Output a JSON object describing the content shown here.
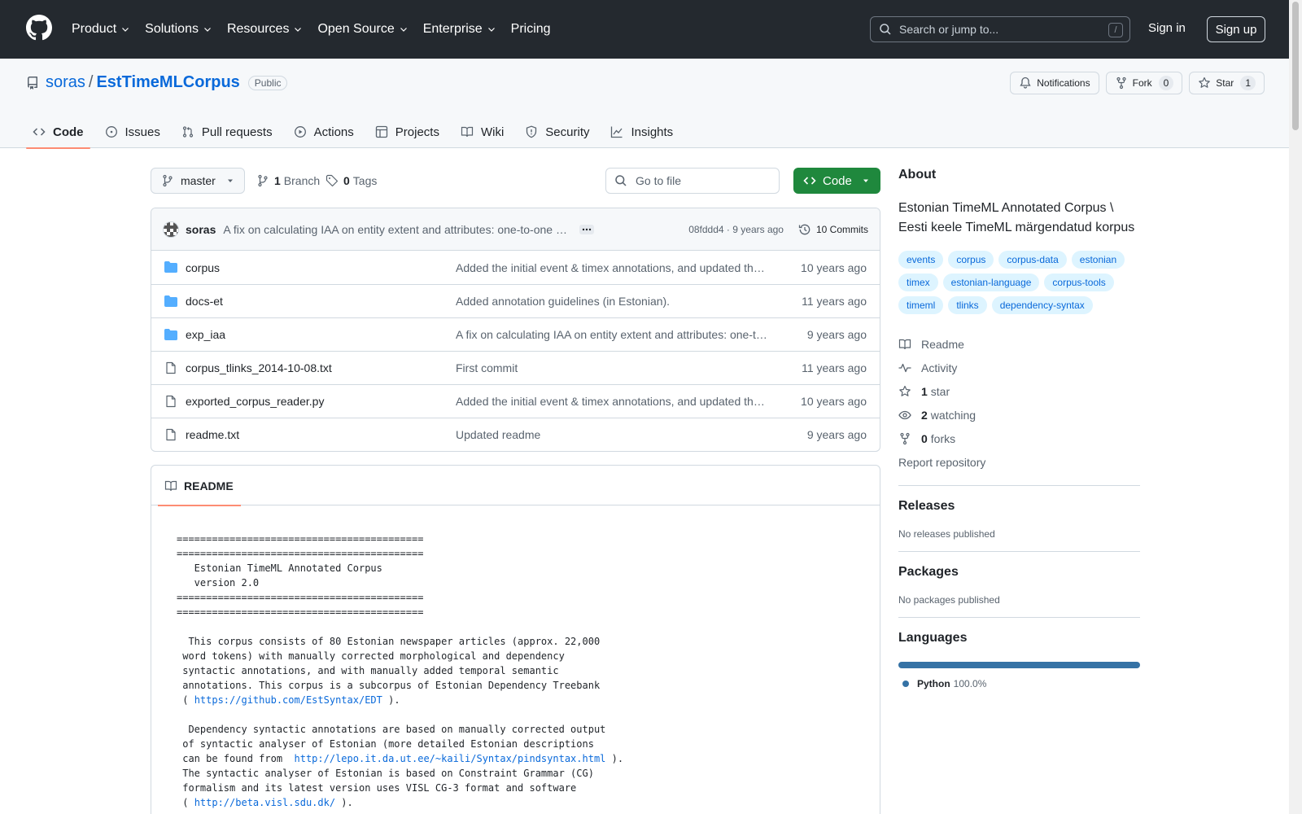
{
  "header": {
    "nav": [
      "Product",
      "Solutions",
      "Resources",
      "Open Source",
      "Enterprise",
      "Pricing"
    ],
    "search_placeholder": "Search or jump to...",
    "search_shortcut": "/",
    "sign_in": "Sign in",
    "sign_up": "Sign up"
  },
  "repo": {
    "owner": "soras",
    "separator": "/",
    "name": "EstTimeMLCorpus",
    "visibility": "Public",
    "notifications_label": "Notifications",
    "fork_label": "Fork",
    "fork_count": "0",
    "star_label": "Star",
    "star_count": "1"
  },
  "tabs": [
    "Code",
    "Issues",
    "Pull requests",
    "Actions",
    "Projects",
    "Wiki",
    "Security",
    "Insights"
  ],
  "toolbar": {
    "branch": "master",
    "branch_count": "1",
    "branch_label": "Branch",
    "tag_count": "0",
    "tag_label": "Tags",
    "goto_placeholder": "Go to file",
    "code_button": "Code"
  },
  "latest_commit": {
    "author": "soras",
    "message": "A fix on calculating IAA on entity extent and attributes: one-to-one entity alignment",
    "sha": "08fddd4",
    "dot": "·",
    "age": "9 years ago",
    "commits_label": "10 Commits"
  },
  "files": [
    {
      "type": "dir",
      "name": "corpus",
      "message": "Added the initial event & timex annotations, and updated the readme",
      "age": "10 years ago"
    },
    {
      "type": "dir",
      "name": "docs-et",
      "message": "Added annotation guidelines (in Estonian).",
      "age": "11 years ago"
    },
    {
      "type": "dir",
      "name": "exp_iaa",
      "message": "A fix on calculating IAA on entity extent and attributes: one-to-one entity alignment",
      "age": "9 years ago"
    },
    {
      "type": "file",
      "name": "corpus_tlinks_2014-10-08.txt",
      "message": "First commit",
      "age": "11 years ago"
    },
    {
      "type": "file",
      "name": "exported_corpus_reader.py",
      "message": "Added the initial event & timex annotations, and updated the readme",
      "age": "10 years ago"
    },
    {
      "type": "file",
      "name": "readme.txt",
      "message": "Updated readme",
      "age": "9 years ago"
    }
  ],
  "readme": {
    "tab_label": "README",
    "lines": [
      "==========================================",
      "==========================================",
      "   Estonian TimeML Annotated Corpus",
      "   version 2.0",
      "==========================================",
      "==========================================",
      "",
      "  This corpus consists of 80 Estonian newspaper articles (approx. 22,000",
      " word tokens) with manually corrected morphological and dependency",
      " syntactic annotations, and with manually added temporal semantic",
      " annotations. This corpus is a subcorpus of Estonian Dependency Treebank",
      " ( |https://github.com/EstSyntax/EDT| ).",
      "",
      "  Dependency syntactic annotations are based on manually corrected output",
      " of syntactic analyser of Estonian (more detailed Estonian descriptions",
      " can be found from  |http://lepo.it.da.ut.ee/~kaili/Syntax/pindsyntax.html| ).",
      " The syntactic analyser of Estonian is based on Constraint Grammar (CG)",
      " formalism and its latest version uses VISL CG-3 format and software",
      " ( |http://beta.visl.sdu.dk/| )."
    ]
  },
  "about": {
    "title": "About",
    "description": "Estonian TimeML Annotated Corpus \\ Eesti keele TimeML märgendatud korpus",
    "topics": [
      "events",
      "corpus",
      "corpus-data",
      "estonian",
      "timex",
      "estonian-language",
      "corpus-tools",
      "timeml",
      "tlinks",
      "dependency-syntax"
    ],
    "readme_link": "Readme",
    "activity_link": "Activity",
    "stars_count": "1",
    "stars_label": "star",
    "watching_count": "2",
    "watching_label": "watching",
    "forks_count": "0",
    "forks_label": "forks",
    "report_link": "Report repository"
  },
  "releases": {
    "title": "Releases",
    "empty": "No releases published"
  },
  "packages": {
    "title": "Packages",
    "empty": "No packages published"
  },
  "languages": {
    "title": "Languages",
    "items": [
      {
        "name": "Python",
        "percent": "100.0%",
        "fraction": 1.0,
        "color": "#3572A5"
      }
    ]
  },
  "colors": {
    "accent": "#0969da",
    "header_bg": "#24292f",
    "code_button": "#1f883d",
    "tab_underline": "#fd8c73"
  }
}
